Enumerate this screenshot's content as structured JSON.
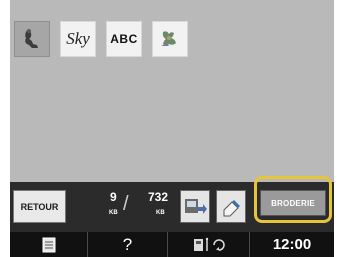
{
  "categories": [
    {
      "name": "embroidery-pattern",
      "icon": "embroidery-figure-icon",
      "selected": true
    },
    {
      "name": "script-font",
      "label": "Sky",
      "selected": false
    },
    {
      "name": "block-font",
      "label": "ABC",
      "selected": false
    },
    {
      "name": "design-pattern",
      "icon": "embroidery-design-icon",
      "selected": false
    }
  ],
  "toolbar": {
    "back_label": "RETOUR",
    "memory_used": "9",
    "memory_used_unit": "KB",
    "memory_total": "732",
    "memory_total_unit": "KB",
    "transfer_icon": "machine-transfer-icon",
    "erase_icon": "eraser-icon",
    "embroidery_label": "BRODERIE"
  },
  "statusbar": {
    "menu_icon": "document-icon",
    "help_label": "?",
    "settings_icon": "threading-settings-icon",
    "time": "12:00"
  },
  "colors": {
    "screen_bg": "#b9b9b9",
    "toolbar_bg": "#2b2b2b",
    "statusbar_bg": "#111111",
    "highlight_frame": "#e7c53a"
  }
}
